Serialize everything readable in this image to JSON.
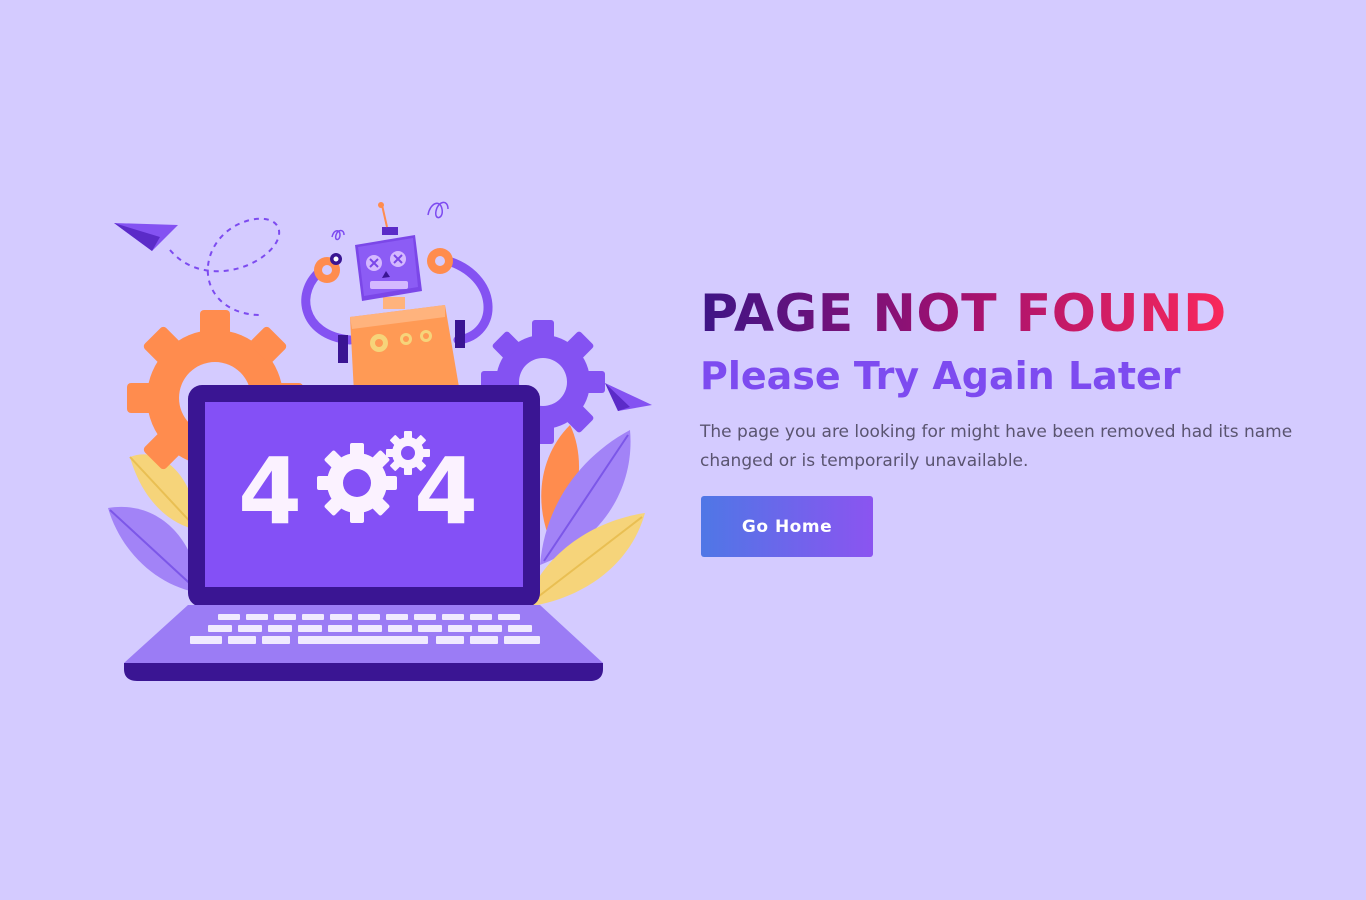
{
  "headline": "PAGE NOT FOUND",
  "subheadline": "Please Try Again Later",
  "description": "The page you are looking for might have been removed had its name changed or is temporarily unavailable.",
  "cta_label": "Go Home",
  "illustration": {
    "screen_text": [
      "4",
      "4"
    ],
    "colors": {
      "background": "#d4cbff",
      "laptop_dark": "#3a1593",
      "screen": "#8450f6",
      "keyboard": "#9b7cf5",
      "gear_orange": "#ff8c4e",
      "gear_purple": "#8452f2",
      "robot_body": "#ff9a55",
      "leaf_yellow": "#f6d47a",
      "leaf_purple": "#a283f7"
    }
  }
}
